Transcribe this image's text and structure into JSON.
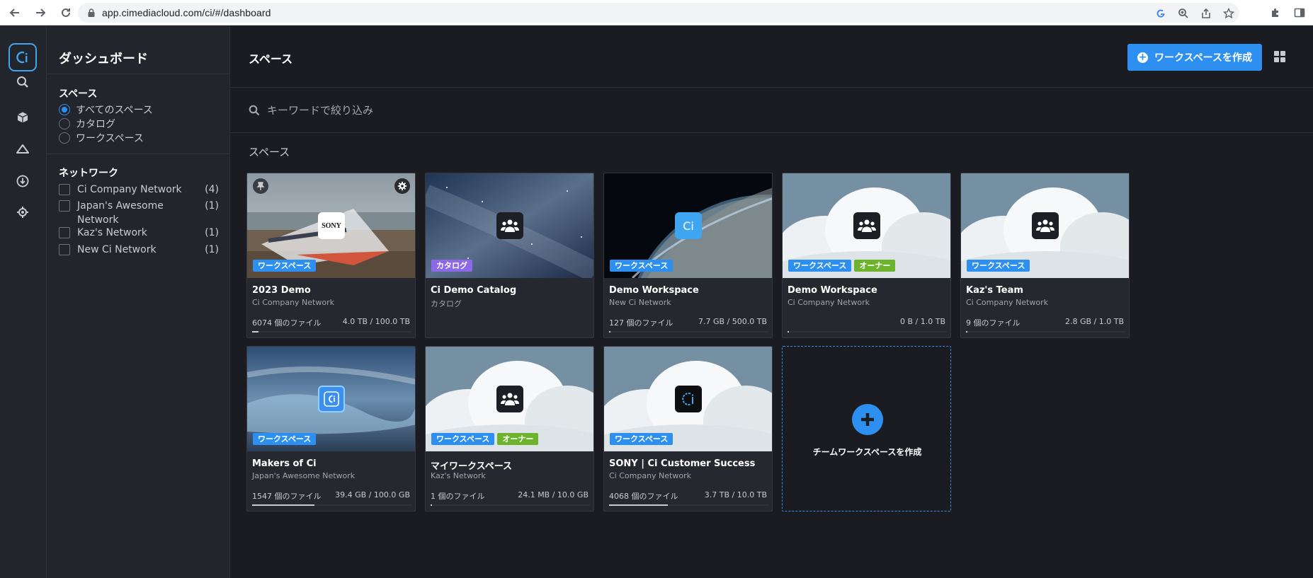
{
  "browser": {
    "url": "app.cimediacloud.com/ci/#/dashboard"
  },
  "sidebar": {
    "title": "ダッシュボード",
    "spaces_heading": "スペース",
    "space_filters": [
      {
        "label": "すべてのスペース",
        "checked": true
      },
      {
        "label": "カタログ",
        "checked": false
      },
      {
        "label": "ワークスペース",
        "checked": false
      }
    ],
    "network_heading": "ネットワーク",
    "networks": [
      {
        "name": "Ci Company Network",
        "count": "(4)"
      },
      {
        "name": "Japan's Awesome Network",
        "count": "(1)"
      },
      {
        "name": "Kaz's Network",
        "count": "(1)"
      },
      {
        "name": "New Ci Network",
        "count": "(1)"
      }
    ]
  },
  "header": {
    "title": "スペース",
    "create_button": "ワークスペースを作成"
  },
  "search": {
    "placeholder": "キーワードで絞り込み"
  },
  "section_label": "スペース",
  "cards": [
    {
      "title": "2023 Demo",
      "subtitle": "Ci Company Network",
      "files": "6074 個のファイル",
      "size": "4.0 TB / 100.0 TB",
      "usage": 0.04,
      "tags": [
        "ワークスペース"
      ]
    },
    {
      "title": "Ci Demo Catalog",
      "subtitle": "カタログ",
      "files": "",
      "size": "",
      "usage": null,
      "tags": [
        "カタログ"
      ]
    },
    {
      "title": "Demo Workspace",
      "subtitle": "New Ci Network",
      "files": "127 個のファイル",
      "size": "7.7 GB / 500.0 TB",
      "usage": 0.0,
      "tags": [
        "ワークスペース"
      ]
    },
    {
      "title": "Demo Workspace",
      "subtitle": "Ci Company Network",
      "files": "",
      "size": "0 B / 1.0 TB",
      "usage": 0.0,
      "tags": [
        "ワークスペース",
        "オーナー"
      ]
    },
    {
      "title": "Kaz's Team",
      "subtitle": "Ci Company Network",
      "files": "9 個のファイル",
      "size": "2.8 GB / 1.0 TB",
      "usage": 0.003,
      "tags": [
        "ワークスペース"
      ]
    },
    {
      "title": "Makers of Ci",
      "subtitle": "Japan's Awesome Network",
      "files": "1547 個のファイル",
      "size": "39.4 GB / 100.0 GB",
      "usage": 0.39,
      "tags": [
        "ワークスペース"
      ]
    },
    {
      "title": "マイワークスペース",
      "subtitle": "Kaz's Network",
      "files": "1 個のファイル",
      "size": "24.1 MB / 10.0 GB",
      "usage": 0.003,
      "tags": [
        "ワークスペース",
        "オーナー"
      ]
    },
    {
      "title": "SONY | Ci Customer Success",
      "subtitle": "Ci Company Network",
      "files": "4068 個のファイル",
      "size": "3.7 TB / 10.0 TB",
      "usage": 0.37,
      "tags": [
        "ワークスペース"
      ]
    }
  ],
  "add_card": {
    "label": "チームワークスペースを作成"
  },
  "logos": {
    "sony": "SONY",
    "ci": "Ci"
  },
  "colors": {
    "accent": "#2d8ff0",
    "owner_tag": "#6db32d",
    "catalog_tag": "#8d68e8"
  }
}
